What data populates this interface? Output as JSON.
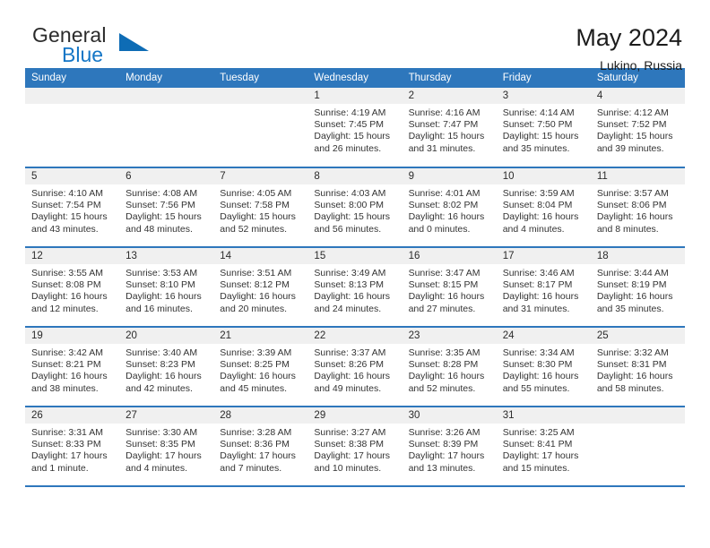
{
  "brand": {
    "name_line1": "General",
    "name_line2": "Blue",
    "triangle_color": "#0e6cb5"
  },
  "header": {
    "title": "May 2024",
    "subtitle": "Lukino, Russia"
  },
  "theme": {
    "header_blue": "#2e77bc",
    "daynum_bg": "#f0f0f0",
    "text": "#333333"
  },
  "weekdays": [
    "Sunday",
    "Monday",
    "Tuesday",
    "Wednesday",
    "Thursday",
    "Friday",
    "Saturday"
  ],
  "weeks": [
    [
      {
        "day": "",
        "sunrise": "",
        "sunset": "",
        "daylight_1": "",
        "daylight_2": ""
      },
      {
        "day": "",
        "sunrise": "",
        "sunset": "",
        "daylight_1": "",
        "daylight_2": ""
      },
      {
        "day": "",
        "sunrise": "",
        "sunset": "",
        "daylight_1": "",
        "daylight_2": ""
      },
      {
        "day": "1",
        "sunrise": "Sunrise: 4:19 AM",
        "sunset": "Sunset: 7:45 PM",
        "daylight_1": "Daylight: 15 hours",
        "daylight_2": "and 26 minutes."
      },
      {
        "day": "2",
        "sunrise": "Sunrise: 4:16 AM",
        "sunset": "Sunset: 7:47 PM",
        "daylight_1": "Daylight: 15 hours",
        "daylight_2": "and 31 minutes."
      },
      {
        "day": "3",
        "sunrise": "Sunrise: 4:14 AM",
        "sunset": "Sunset: 7:50 PM",
        "daylight_1": "Daylight: 15 hours",
        "daylight_2": "and 35 minutes."
      },
      {
        "day": "4",
        "sunrise": "Sunrise: 4:12 AM",
        "sunset": "Sunset: 7:52 PM",
        "daylight_1": "Daylight: 15 hours",
        "daylight_2": "and 39 minutes."
      }
    ],
    [
      {
        "day": "5",
        "sunrise": "Sunrise: 4:10 AM",
        "sunset": "Sunset: 7:54 PM",
        "daylight_1": "Daylight: 15 hours",
        "daylight_2": "and 43 minutes."
      },
      {
        "day": "6",
        "sunrise": "Sunrise: 4:08 AM",
        "sunset": "Sunset: 7:56 PM",
        "daylight_1": "Daylight: 15 hours",
        "daylight_2": "and 48 minutes."
      },
      {
        "day": "7",
        "sunrise": "Sunrise: 4:05 AM",
        "sunset": "Sunset: 7:58 PM",
        "daylight_1": "Daylight: 15 hours",
        "daylight_2": "and 52 minutes."
      },
      {
        "day": "8",
        "sunrise": "Sunrise: 4:03 AM",
        "sunset": "Sunset: 8:00 PM",
        "daylight_1": "Daylight: 15 hours",
        "daylight_2": "and 56 minutes."
      },
      {
        "day": "9",
        "sunrise": "Sunrise: 4:01 AM",
        "sunset": "Sunset: 8:02 PM",
        "daylight_1": "Daylight: 16 hours",
        "daylight_2": "and 0 minutes."
      },
      {
        "day": "10",
        "sunrise": "Sunrise: 3:59 AM",
        "sunset": "Sunset: 8:04 PM",
        "daylight_1": "Daylight: 16 hours",
        "daylight_2": "and 4 minutes."
      },
      {
        "day": "11",
        "sunrise": "Sunrise: 3:57 AM",
        "sunset": "Sunset: 8:06 PM",
        "daylight_1": "Daylight: 16 hours",
        "daylight_2": "and 8 minutes."
      }
    ],
    [
      {
        "day": "12",
        "sunrise": "Sunrise: 3:55 AM",
        "sunset": "Sunset: 8:08 PM",
        "daylight_1": "Daylight: 16 hours",
        "daylight_2": "and 12 minutes."
      },
      {
        "day": "13",
        "sunrise": "Sunrise: 3:53 AM",
        "sunset": "Sunset: 8:10 PM",
        "daylight_1": "Daylight: 16 hours",
        "daylight_2": "and 16 minutes."
      },
      {
        "day": "14",
        "sunrise": "Sunrise: 3:51 AM",
        "sunset": "Sunset: 8:12 PM",
        "daylight_1": "Daylight: 16 hours",
        "daylight_2": "and 20 minutes."
      },
      {
        "day": "15",
        "sunrise": "Sunrise: 3:49 AM",
        "sunset": "Sunset: 8:13 PM",
        "daylight_1": "Daylight: 16 hours",
        "daylight_2": "and 24 minutes."
      },
      {
        "day": "16",
        "sunrise": "Sunrise: 3:47 AM",
        "sunset": "Sunset: 8:15 PM",
        "daylight_1": "Daylight: 16 hours",
        "daylight_2": "and 27 minutes."
      },
      {
        "day": "17",
        "sunrise": "Sunrise: 3:46 AM",
        "sunset": "Sunset: 8:17 PM",
        "daylight_1": "Daylight: 16 hours",
        "daylight_2": "and 31 minutes."
      },
      {
        "day": "18",
        "sunrise": "Sunrise: 3:44 AM",
        "sunset": "Sunset: 8:19 PM",
        "daylight_1": "Daylight: 16 hours",
        "daylight_2": "and 35 minutes."
      }
    ],
    [
      {
        "day": "19",
        "sunrise": "Sunrise: 3:42 AM",
        "sunset": "Sunset: 8:21 PM",
        "daylight_1": "Daylight: 16 hours",
        "daylight_2": "and 38 minutes."
      },
      {
        "day": "20",
        "sunrise": "Sunrise: 3:40 AM",
        "sunset": "Sunset: 8:23 PM",
        "daylight_1": "Daylight: 16 hours",
        "daylight_2": "and 42 minutes."
      },
      {
        "day": "21",
        "sunrise": "Sunrise: 3:39 AM",
        "sunset": "Sunset: 8:25 PM",
        "daylight_1": "Daylight: 16 hours",
        "daylight_2": "and 45 minutes."
      },
      {
        "day": "22",
        "sunrise": "Sunrise: 3:37 AM",
        "sunset": "Sunset: 8:26 PM",
        "daylight_1": "Daylight: 16 hours",
        "daylight_2": "and 49 minutes."
      },
      {
        "day": "23",
        "sunrise": "Sunrise: 3:35 AM",
        "sunset": "Sunset: 8:28 PM",
        "daylight_1": "Daylight: 16 hours",
        "daylight_2": "and 52 minutes."
      },
      {
        "day": "24",
        "sunrise": "Sunrise: 3:34 AM",
        "sunset": "Sunset: 8:30 PM",
        "daylight_1": "Daylight: 16 hours",
        "daylight_2": "and 55 minutes."
      },
      {
        "day": "25",
        "sunrise": "Sunrise: 3:32 AM",
        "sunset": "Sunset: 8:31 PM",
        "daylight_1": "Daylight: 16 hours",
        "daylight_2": "and 58 minutes."
      }
    ],
    [
      {
        "day": "26",
        "sunrise": "Sunrise: 3:31 AM",
        "sunset": "Sunset: 8:33 PM",
        "daylight_1": "Daylight: 17 hours",
        "daylight_2": "and 1 minute."
      },
      {
        "day": "27",
        "sunrise": "Sunrise: 3:30 AM",
        "sunset": "Sunset: 8:35 PM",
        "daylight_1": "Daylight: 17 hours",
        "daylight_2": "and 4 minutes."
      },
      {
        "day": "28",
        "sunrise": "Sunrise: 3:28 AM",
        "sunset": "Sunset: 8:36 PM",
        "daylight_1": "Daylight: 17 hours",
        "daylight_2": "and 7 minutes."
      },
      {
        "day": "29",
        "sunrise": "Sunrise: 3:27 AM",
        "sunset": "Sunset: 8:38 PM",
        "daylight_1": "Daylight: 17 hours",
        "daylight_2": "and 10 minutes."
      },
      {
        "day": "30",
        "sunrise": "Sunrise: 3:26 AM",
        "sunset": "Sunset: 8:39 PM",
        "daylight_1": "Daylight: 17 hours",
        "daylight_2": "and 13 minutes."
      },
      {
        "day": "31",
        "sunrise": "Sunrise: 3:25 AM",
        "sunset": "Sunset: 8:41 PM",
        "daylight_1": "Daylight: 17 hours",
        "daylight_2": "and 15 minutes."
      },
      {
        "day": "",
        "sunrise": "",
        "sunset": "",
        "daylight_1": "",
        "daylight_2": ""
      }
    ]
  ]
}
